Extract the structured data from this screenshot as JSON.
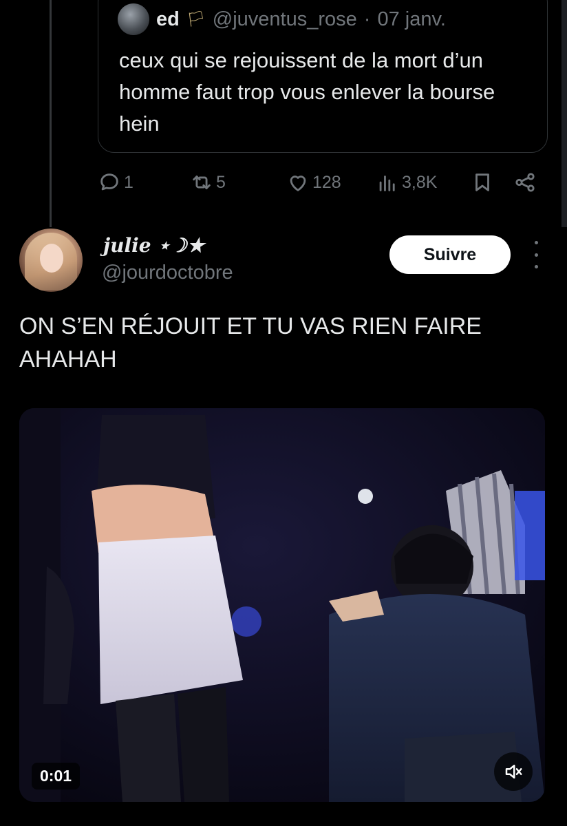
{
  "quoted_tweet": {
    "author_name": "ed",
    "flag_glyph": "🏳",
    "handle": "@juventus_rose",
    "separator": "·",
    "date": "07 janv.",
    "text": "ceux qui se rejouissent de la mort d’un homme faut trop vous enlever la bourse hein"
  },
  "actions": {
    "replies": "1",
    "reposts": "5",
    "likes": "128",
    "views": "3,8K"
  },
  "tweet": {
    "display_name": "julie ⋆☽★",
    "handle": "@jourdoctobre",
    "follow_label": "Suivre",
    "text": "ON S’EN RÉJOUIT ET TU VAS RIEN FAIRE AHAHAH"
  },
  "video": {
    "duration": "0:01"
  },
  "icons": {
    "reply": "reply-icon",
    "repost": "repost-icon",
    "like": "heart-icon",
    "views": "views-icon",
    "bookmark": "bookmark-icon",
    "share": "share-icon",
    "more": "more-vertical-icon",
    "mute": "muted-speaker-icon"
  },
  "colors": {
    "background": "#000000",
    "text": "#e7e9ea",
    "secondary": "#71767b",
    "border": "#2f3336",
    "follow_bg": "#ffffff"
  }
}
